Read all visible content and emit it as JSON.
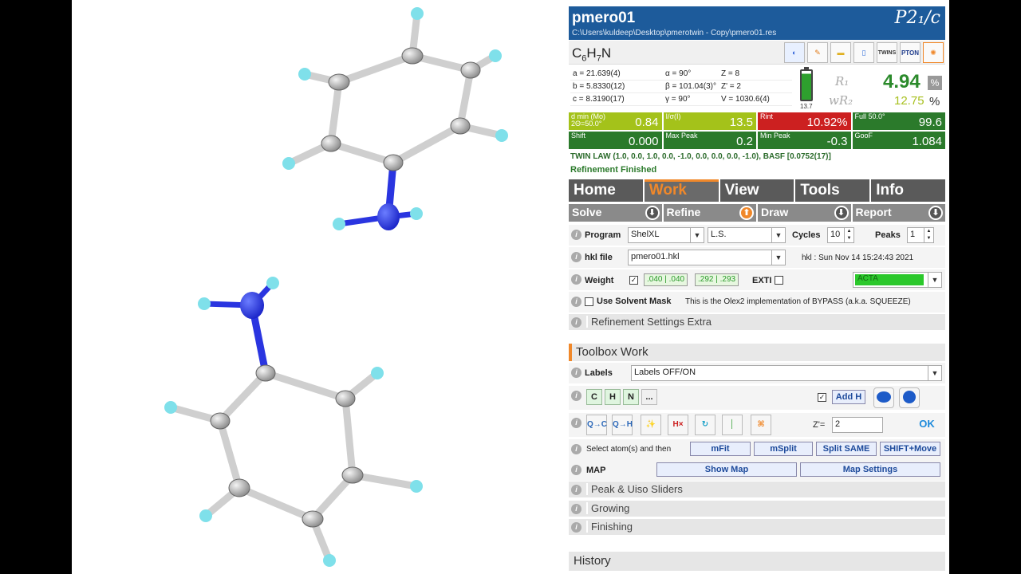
{
  "structure": {
    "name": "pmero01",
    "path": "C:\\Users\\kuldeep\\Desktop\\pmerotwin - Copy\\pmero01.res",
    "space_group": "P2₁/c"
  },
  "formula": {
    "C": "C",
    "c_n": "6",
    "H": "H",
    "h_n": "7",
    "N": "N"
  },
  "toolbar_icons": [
    "paint-icon",
    "pencil-icon",
    "folder-icon",
    "notepad-icon",
    "twins-icon",
    "pton-icon",
    "settings-icon"
  ],
  "toolbar_labels": {
    "twins": "TWINS",
    "pton": "PTON"
  },
  "cell": {
    "a": "a = 21.639(4)",
    "alpha": "α = 90°",
    "z": "Z = 8",
    "b": "b = 5.8330(12)",
    "beta": "β = 101.04(3)°",
    "zp": "Z' = 2",
    "c": "c = 8.3190(17)",
    "gamma": "γ = 90°",
    "v": "V = 1030.6(4)"
  },
  "battery_label": "13.7",
  "r_factors": {
    "r1_label": "R₁",
    "r1": "4.94",
    "wr2_label": "wR₂",
    "wr2": "12.75",
    "pct": "%"
  },
  "stats": [
    {
      "label": "d min (Mo)",
      "sub": "2Θ=50.0°",
      "value": "0.84",
      "color": "#a4c21a"
    },
    {
      "label": "I/σ(I)",
      "sub": "",
      "value": "13.5",
      "color": "#a4c21a"
    },
    {
      "label": "Rint",
      "sub": "",
      "value": "10.92%",
      "color": "#cc2020"
    },
    {
      "label": "Full 50.0°",
      "sub": "",
      "value": "99.6",
      "color": "#2b7a2b"
    },
    {
      "label": "Shift",
      "sub": "",
      "value": "0.000",
      "color": "#2b7a2b"
    },
    {
      "label": "Max Peak",
      "sub": "",
      "value": "0.2",
      "color": "#2b7a2b"
    },
    {
      "label": "Min Peak",
      "sub": "",
      "value": "-0.3",
      "color": "#2b7a2b"
    },
    {
      "label": "GooF",
      "sub": "",
      "value": "1.084",
      "color": "#2b7a2b"
    }
  ],
  "twin_law": "TWIN LAW (1.0, 0.0, 1.0, 0.0, -1.0, 0.0, 0.0, 0.0, -1.0), BASF [0.0752(17)]",
  "status": "Refinement Finished",
  "tabs": [
    "Home",
    "Work",
    "View",
    "Tools",
    "Info"
  ],
  "active_tab": "Work",
  "subtabs": [
    "Solve",
    "Refine",
    "Draw",
    "Report"
  ],
  "refine": {
    "program_label": "Program",
    "program": "ShelXL",
    "method": "L.S.",
    "cycles_label": "Cycles",
    "cycles": "10",
    "peaks_label": "Peaks",
    "peaks": "1",
    "hkl_label": "hkl file",
    "hkl": "pmero01.hkl",
    "hkl_date": "hkl : Sun Nov 14 15:24:43 2021",
    "weight_label": "Weight",
    "w1": ".040 | .040",
    "w2": ".292 | .293",
    "exti_label": "EXTI",
    "acta": "ACTA",
    "solvent_label": "Use Solvent Mask",
    "solvent_note": "This is the Olex2 implementation of BYPASS (a.k.a. SQUEEZE)",
    "extra": "Refinement Settings Extra"
  },
  "toolbox": {
    "title": "Toolbox Work",
    "labels_label": "Labels",
    "labels_value": "Labels OFF/ON",
    "elements": [
      "C",
      "H",
      "N",
      "..."
    ],
    "add_h": "Add H",
    "tool_icons": [
      {
        "name": "q-to-c-icon",
        "label": "Q→C"
      },
      {
        "name": "q-to-h-icon",
        "label": "Q→H"
      },
      {
        "name": "broom-icon",
        "label": "✨"
      },
      {
        "name": "delete-h-icon",
        "label": "H×"
      },
      {
        "name": "rotate-icon",
        "label": "↻"
      },
      {
        "name": "bond-icon",
        "label": "│"
      },
      {
        "name": "atom-cell-icon",
        "label": "⌘"
      }
    ],
    "z_label": "Z'=",
    "z_value": "2",
    "select_label": "Select atom(s) and then",
    "btns": [
      "mFit",
      "mSplit",
      "Split SAME",
      "SHIFT+Move"
    ],
    "map_label": "MAP",
    "show_map": "Show Map",
    "map_settings": "Map Settings",
    "sections": [
      "Peak & Uiso Sliders",
      "Growing",
      "Finishing"
    ]
  },
  "history": "History"
}
